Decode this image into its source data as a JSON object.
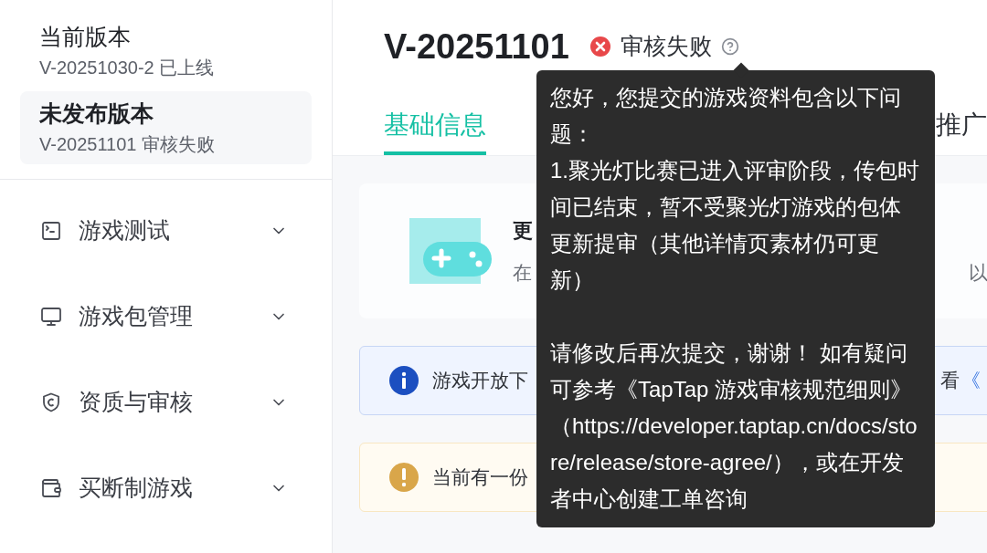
{
  "sidebar": {
    "versions": [
      {
        "label": "当前版本",
        "detail": "V-20251030-2 已上线",
        "selected": false
      },
      {
        "label": "未发布版本",
        "detail": "V-20251101 审核失败",
        "selected": true
      }
    ],
    "nav": [
      {
        "kind": "terminal",
        "label": "游戏测试",
        "expanded": false
      },
      {
        "kind": "monitor",
        "label": "游戏包管理",
        "expanded": false
      },
      {
        "kind": "shield",
        "label": "资质与审核",
        "expanded": false
      },
      {
        "kind": "wallet",
        "label": "买断制游戏",
        "expanded": false
      }
    ]
  },
  "header": {
    "title": "V-20251101",
    "status": {
      "kind": "failed",
      "label": "审核失败"
    }
  },
  "tabs": [
    {
      "label": "基础信息",
      "selected": true
    },
    {
      "label": "推广",
      "selected": false
    }
  ],
  "update_card": {
    "title": "更",
    "subtitle": "在",
    "subtitle_tail": "以"
  },
  "notices": [
    {
      "kind": "info",
      "text": "游戏开放下",
      "tail": "看",
      "link": "《"
    },
    {
      "kind": "warning",
      "text": "当前有一份"
    }
  ],
  "tooltip": {
    "paragraphs": [
      "您好，您提交的游戏资料包含以下问题：",
      "1.聚光灯比赛已进入评审阶段，传包时间已结束，暂不受聚光灯游戏的包体更新提审（其他详情页素材仍可更新）"
    ],
    "closing": "请修改后再次提交，谢谢！ 如有疑问可参考《TapTap 游戏审核规范细则》（https://developer.taptap.cn/docs/store/release/store-agree/），或在开发者中心创建工单咨询"
  }
}
